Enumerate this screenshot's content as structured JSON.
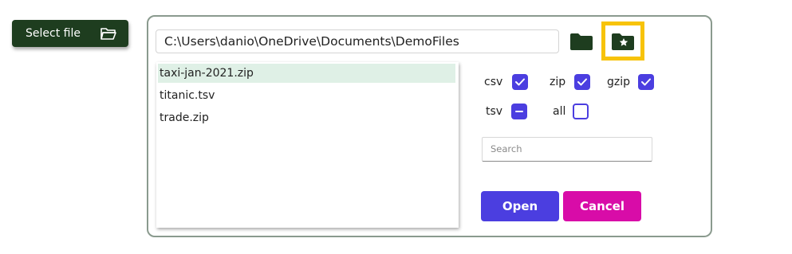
{
  "select_file": {
    "label": "Select file",
    "icon": "folder-open-icon"
  },
  "dialog": {
    "path": "C:\\Users\\danio\\OneDrive\\Documents\\DemoFiles",
    "folder_icon": "folder-icon",
    "favorites_icon": "folder-star-icon",
    "files": [
      {
        "name": "taxi-jan-2021.zip",
        "selected": true
      },
      {
        "name": "titanic.tsv",
        "selected": false
      },
      {
        "name": "trade.zip",
        "selected": false
      }
    ],
    "filters": {
      "csv": {
        "label": "csv",
        "state": "checked"
      },
      "zip": {
        "label": "zip",
        "state": "checked"
      },
      "gzip": {
        "label": "gzip",
        "state": "checked"
      },
      "tsv": {
        "label": "tsv",
        "state": "mixed"
      },
      "all": {
        "label": "all",
        "state": "unchecked"
      }
    },
    "search_placeholder": "Search",
    "open_label": "Open",
    "cancel_label": "Cancel"
  },
  "colors": {
    "primary": "#4b3ee0",
    "danger": "#d80ca8",
    "dark_green": "#1e3d1f",
    "highlight": "#f7c30a",
    "selection": "#dff0e6"
  }
}
